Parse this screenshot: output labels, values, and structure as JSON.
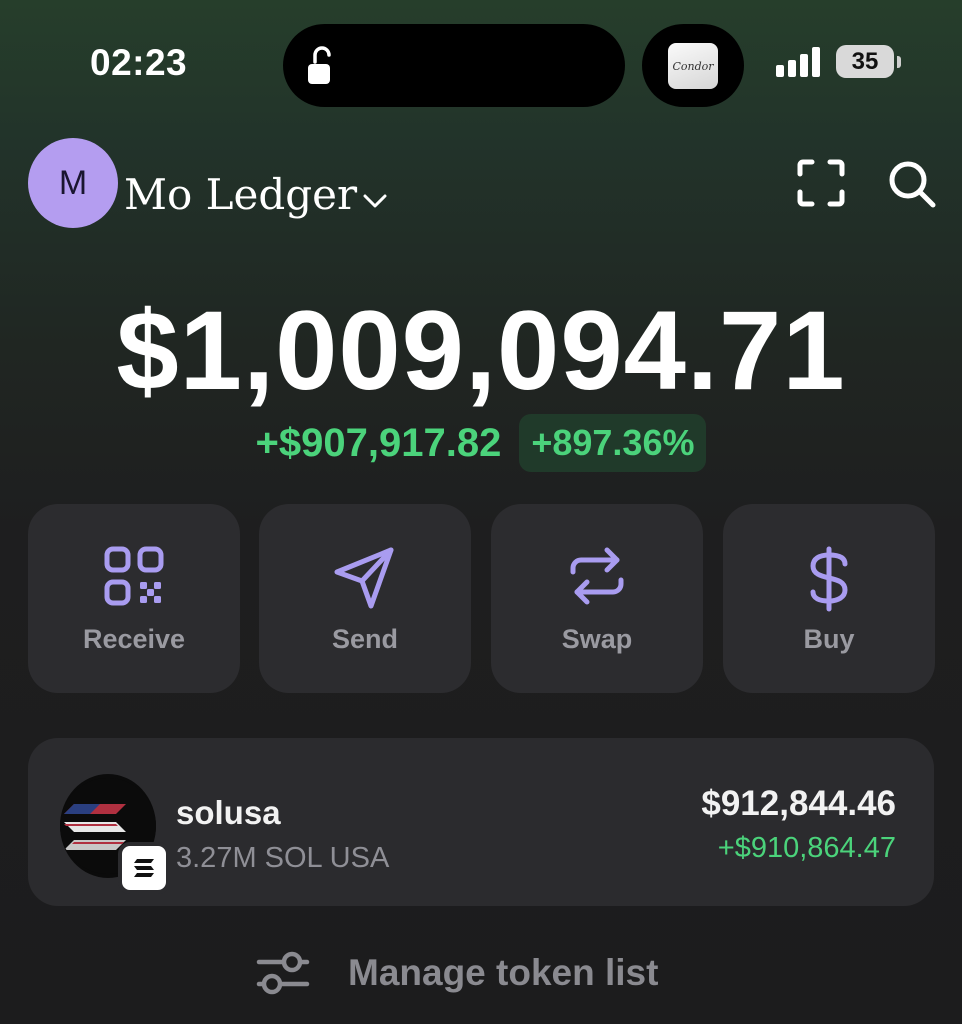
{
  "status_bar": {
    "time": "02:23",
    "battery": "35"
  },
  "account": {
    "avatar_initial": "M",
    "name": "Mo Ledger"
  },
  "balance": {
    "total": "$1,009,094.71",
    "change_amount": "+$907,917.82",
    "change_percent": "+897.36%"
  },
  "actions": [
    {
      "label": "Receive",
      "icon": "qr-code-icon"
    },
    {
      "label": "Send",
      "icon": "send-icon"
    },
    {
      "label": "Swap",
      "icon": "swap-icon"
    },
    {
      "label": "Buy",
      "icon": "dollar-icon"
    }
  ],
  "tokens": [
    {
      "name": "solusa",
      "amount": "3.27M SOL USA",
      "value": "$912,844.46",
      "change": "+$910,864.47"
    }
  ],
  "manage": {
    "label": "Manage token list"
  },
  "colors": {
    "accent": "#a99cf0",
    "positive": "#4bd37b",
    "card": "#2c2c2f",
    "avatar": "#b49df0"
  }
}
